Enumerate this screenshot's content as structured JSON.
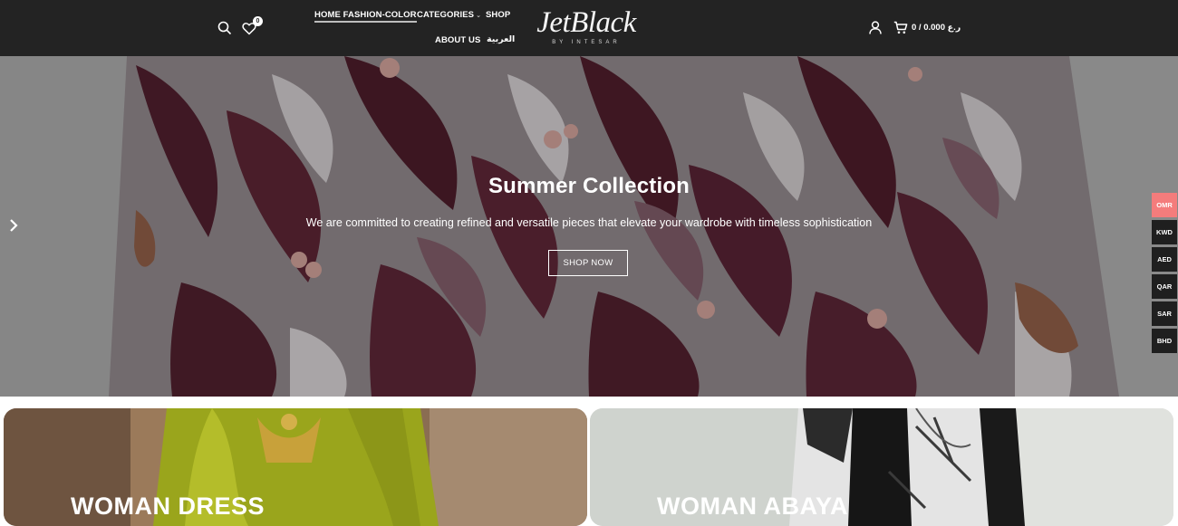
{
  "header": {
    "nav": {
      "home": "HOME FASHION-COLOR",
      "categories": "CATEGORIES",
      "shop": "SHOP",
      "about": "ABOUT US",
      "arabic": "العربية"
    },
    "wishlist_count": "0",
    "logo_text": "JetBlack",
    "logo_sub": "BY INTESAR",
    "cart_text": "0 / 0.000 ر.ع"
  },
  "hero": {
    "title": "Summer Collection",
    "subtitle": "We are committed to creating refined and versatile pieces that elevate your wardrobe with timeless sophistication",
    "button": "SHOP NOW"
  },
  "currencies": [
    "OMR",
    "KWD",
    "AED",
    "QAR",
    "SAR",
    "BHD"
  ],
  "cards": {
    "left_title": "WOMAN DRESS",
    "right_title": "WOMAN ABAYA"
  },
  "colors": {
    "header_bg": "#232323",
    "active_currency": "#f47c7c",
    "currency_bg": "#1f1f1f"
  }
}
